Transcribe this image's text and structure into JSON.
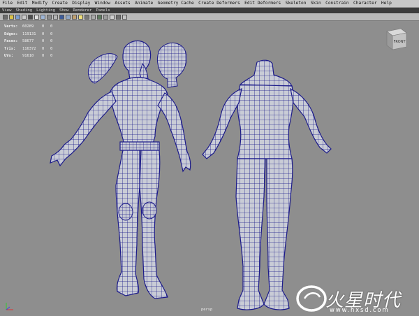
{
  "menu": [
    "File",
    "Edit",
    "Modify",
    "Create",
    "Display",
    "Window",
    "Assets",
    "Animate",
    "Geometry Cache",
    "Create Deformers",
    "Edit Deformers",
    "Skeleton",
    "Skin",
    "Constrain",
    "Character",
    "Help"
  ],
  "panel_menu": [
    "View",
    "Shading",
    "Lighting",
    "Show",
    "Renderer",
    "Panels"
  ],
  "hud": [
    {
      "label": "Verts:",
      "value": "60289",
      "v2": "0",
      "v3": "0"
    },
    {
      "label": "Edges:",
      "value": "119131",
      "v2": "0",
      "v3": "0"
    },
    {
      "label": "Faces:",
      "value": "58677",
      "v2": "0",
      "v3": "0"
    },
    {
      "label": "Tris:",
      "value": "116372",
      "v2": "0",
      "v3": "0"
    },
    {
      "label": "UVs:",
      "value": "91610",
      "v2": "0",
      "v3": "0"
    }
  ],
  "viewcube_label": "FRONT",
  "camera_label": "persp",
  "watermark": {
    "title": "火星时代",
    "url": "www.hxsd.com"
  },
  "colors": {
    "wire": "#1c1b8a",
    "mesh_fill": "#c9ccd6",
    "viewport_bg": "#8e8e8e",
    "menubar_bg": "#c7c7c7",
    "panelbar_bg": "#3c3c3c"
  }
}
